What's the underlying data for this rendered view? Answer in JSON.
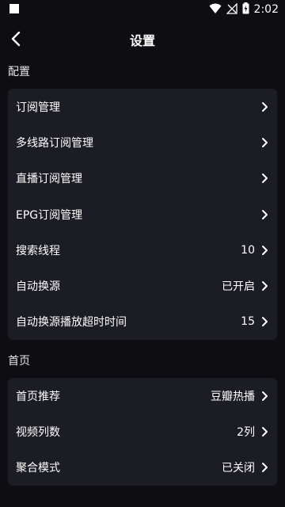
{
  "status_bar": {
    "time": "2:02",
    "icons": [
      "notification-square-icon",
      "wifi-icon",
      "no-signal-icon",
      "battery-charging-icon"
    ]
  },
  "header": {
    "title": "设置",
    "back_icon": "chevron-left-icon"
  },
  "sections": [
    {
      "label": "配置",
      "items": [
        {
          "label": "订阅管理",
          "value": ""
        },
        {
          "label": "多线路订阅管理",
          "value": ""
        },
        {
          "label": "直播订阅管理",
          "value": ""
        },
        {
          "label": "EPG订阅管理",
          "value": ""
        },
        {
          "label": "搜索线程",
          "value": "10"
        },
        {
          "label": "自动换源",
          "value": "已开启"
        },
        {
          "label": "自动换源播放超时时间",
          "value": "15"
        }
      ]
    },
    {
      "label": "首页",
      "items": [
        {
          "label": "首页推荐",
          "value": "豆瓣热播"
        },
        {
          "label": "视频列数",
          "value": "2列"
        },
        {
          "label": "聚合模式",
          "value": "已关闭"
        }
      ]
    }
  ],
  "colors": {
    "background": "#0d0d12",
    "card": "#1c1d24",
    "text": "#ffffff"
  }
}
